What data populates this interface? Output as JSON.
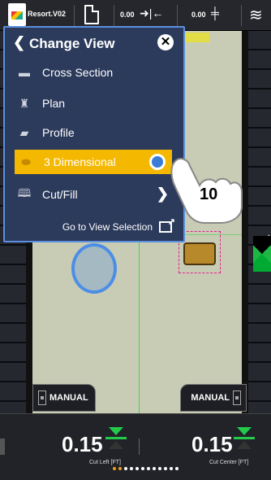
{
  "topbar": {
    "project_name": "Resort.V02",
    "horizontal_offset": "0.00",
    "vertical_offset": "0.00"
  },
  "menu": {
    "title": "Change View",
    "items": [
      {
        "label": "Cross Section",
        "icon": "cross-section-icon"
      },
      {
        "label": "Plan",
        "icon": "plan-icon"
      },
      {
        "label": "Profile",
        "icon": "profile-icon"
      },
      {
        "label": "3 Dimensional",
        "icon": "3d-icon",
        "selected": true
      },
      {
        "label": "Cut/Fill",
        "icon": "book-icon",
        "has_submenu": true
      }
    ],
    "link_label": "Go to View Selection"
  },
  "tap_hint": {
    "count": "10"
  },
  "manual_left": {
    "label": "MANUAL"
  },
  "manual_right": {
    "label": "MANUAL"
  },
  "readouts": {
    "left": {
      "value": "0.15",
      "label": "Cut Left  [FT]"
    },
    "right": {
      "value": "0.15",
      "label": "Cut Center  [FT]"
    }
  },
  "colors": {
    "accent": "#f5b800",
    "menu_bg": "#2c3a5c",
    "menu_border": "#5b8fe0",
    "grade_green": "#22c94a"
  }
}
